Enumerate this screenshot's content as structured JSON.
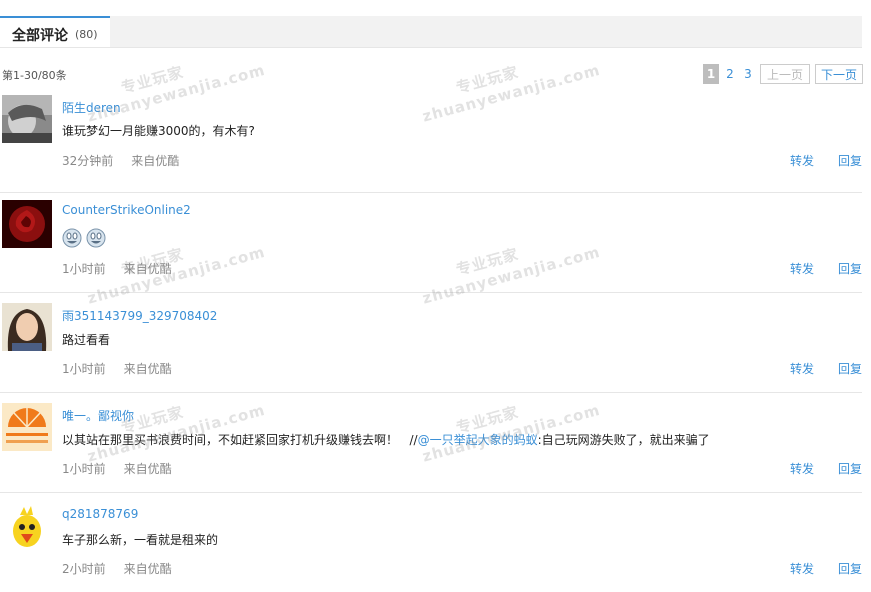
{
  "tab": {
    "title": "全部评论",
    "count": "(80)"
  },
  "range_text": "第1-30/80条",
  "pager": {
    "current": "1",
    "pages": [
      "2",
      "3"
    ],
    "prev": "上一页",
    "next": "下一页"
  },
  "comments": [
    {
      "user": "陌生deren",
      "text": "谁玩梦幻一月能赚3000的，有木有?",
      "time": "32分钟前",
      "source": "来自优酷",
      "forward": "转发",
      "reply": "回复",
      "avatar": "grayscale-face"
    },
    {
      "user": "CounterStrikeOnline2",
      "text": "",
      "emoticons": [
        "laughing-emoticon",
        "laughing-emoticon"
      ],
      "time": "1小时前",
      "source": "来自优酷",
      "forward": "转发",
      "reply": "回复",
      "avatar": "red-rose"
    },
    {
      "user": "雨351143799_329708402",
      "text": "路过看看",
      "time": "1小时前",
      "source": "来自优酷",
      "forward": "转发",
      "reply": "回复",
      "avatar": "girl-portrait"
    },
    {
      "user": "唯一。鄙视你",
      "text": "以其站在那里买书浪费时间，不如赶紧回家打机升级赚钱去啊！",
      "quote_prefix": "//",
      "mention": "@一只举起大象的蚂蚁",
      "quote_text": ":自己玩网游失败了，就出来骗了",
      "time": "1小时前",
      "source": "来自优酷",
      "forward": "转发",
      "reply": "回复",
      "avatar": "orange-sunset"
    },
    {
      "user": "q281878769",
      "text": "车子那么新，一看就是租来的",
      "time": "2小时前",
      "source": "来自优酷",
      "forward": "转发",
      "reply": "回复",
      "avatar": "yellow-chick-cartoon"
    }
  ],
  "watermark": {
    "cn": "专业玩家",
    "en": "zhuanyewanjia.com"
  }
}
